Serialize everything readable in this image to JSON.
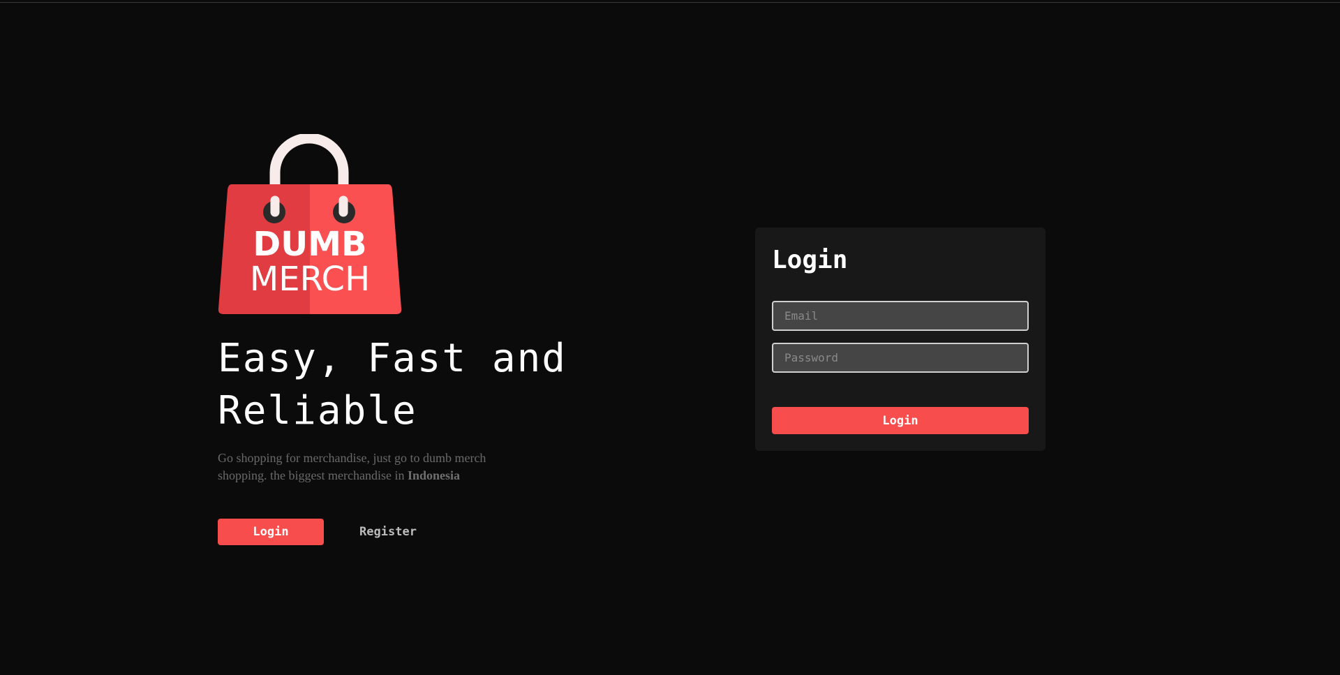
{
  "colors": {
    "background": "#0b0b0b",
    "accent": "#f74d4d",
    "bag_left": "#e03c41",
    "bag_right": "#fa5052",
    "card": "#181818",
    "input_bg": "#454545"
  },
  "logo": {
    "icon": "shopping-bag-icon",
    "line1": "DUMB",
    "line2": "MERCH"
  },
  "hero": {
    "headline": "Easy, Fast and Reliable",
    "tagline_prefix": "Go shopping for merchandise, just go to dumb merch shopping. the biggest merchandise in ",
    "tagline_emphasis": "Indonesia",
    "login_label": "Login",
    "register_label": "Register"
  },
  "login_card": {
    "title": "Login",
    "email_placeholder": "Email",
    "password_placeholder": "Password",
    "submit_label": "Login"
  }
}
